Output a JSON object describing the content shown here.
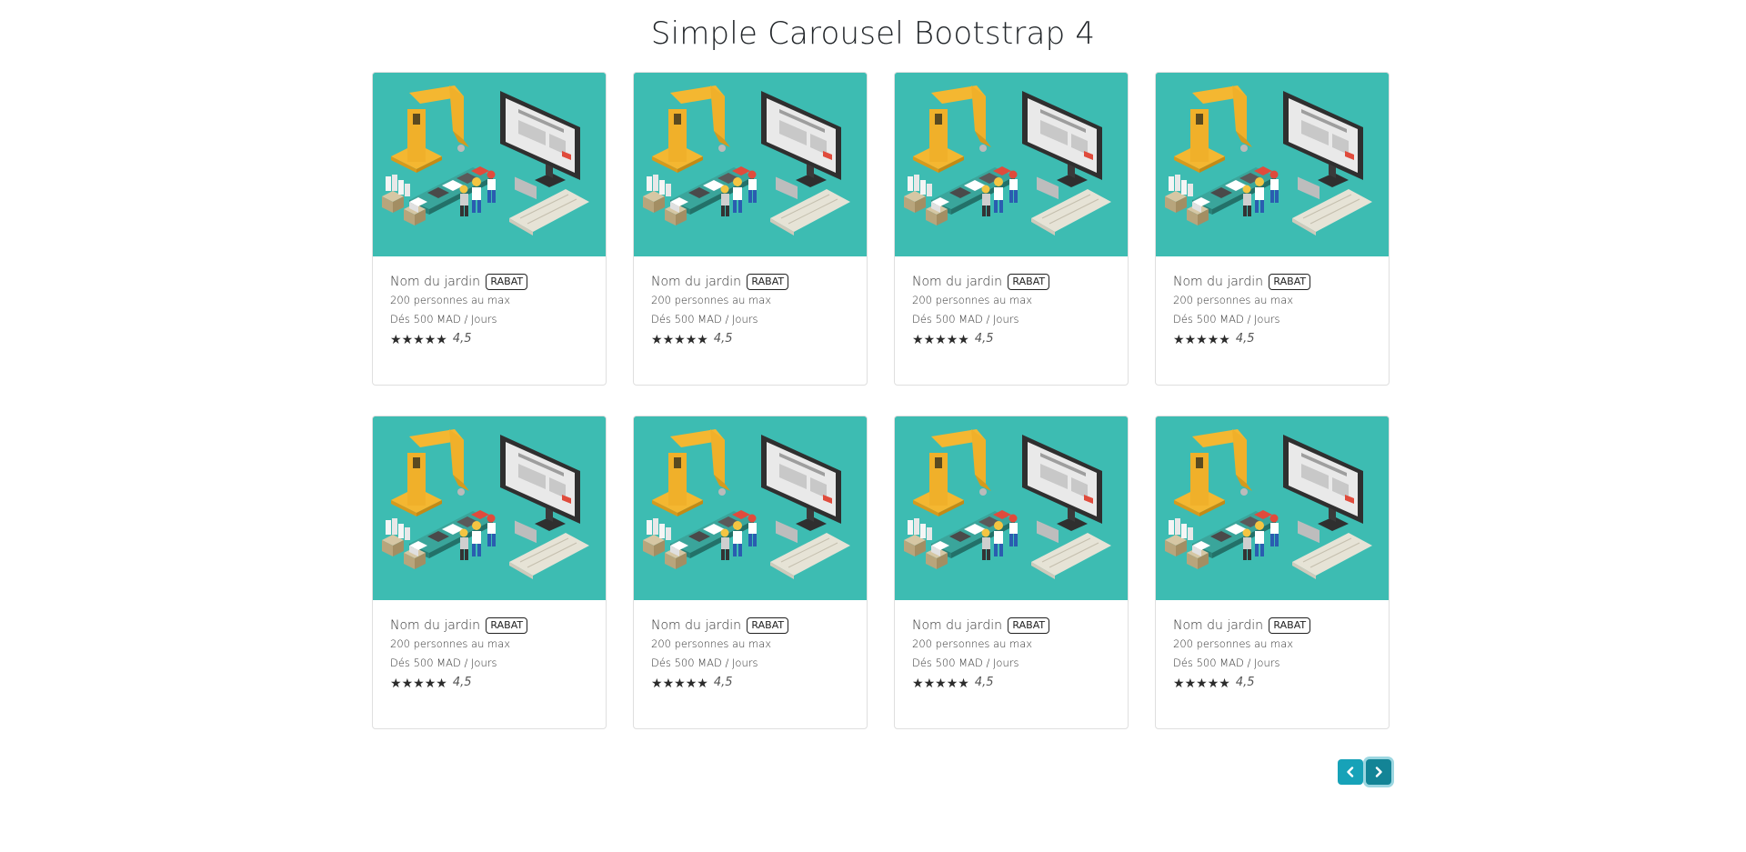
{
  "page": {
    "title": "Simple Carousel Bootstrap 4"
  },
  "theme": {
    "image_bg": "#3dbcb2",
    "button_bg": "#17a2b8"
  },
  "cards": [
    {
      "name": "Nom du jardin",
      "city": "RABAT",
      "capacity": "200 personnes au max",
      "price": "Dés 500 MAD / Jours",
      "stars": 5,
      "rating": "4,5",
      "image": "factory-illustration"
    },
    {
      "name": "Nom du jardin",
      "city": "RABAT",
      "capacity": "200 personnes au max",
      "price": "Dés 500 MAD / Jours",
      "stars": 5,
      "rating": "4,5",
      "image": "factory-illustration"
    },
    {
      "name": "Nom du jardin",
      "city": "RABAT",
      "capacity": "200 personnes au max",
      "price": "Dés 500 MAD / Jours",
      "stars": 5,
      "rating": "4,5",
      "image": "factory-illustration"
    },
    {
      "name": "Nom du jardin",
      "city": "RABAT",
      "capacity": "200 personnes au max",
      "price": "Dés 500 MAD / Jours",
      "stars": 5,
      "rating": "4,5",
      "image": "factory-illustration"
    },
    {
      "name": "Nom du jardin",
      "city": "RABAT",
      "capacity": "200 personnes au max",
      "price": "Dés 500 MAD / Jours",
      "stars": 5,
      "rating": "4,5",
      "image": "factory-illustration"
    },
    {
      "name": "Nom du jardin",
      "city": "RABAT",
      "capacity": "200 personnes au max",
      "price": "Dés 500 MAD / Jours",
      "stars": 5,
      "rating": "4,5",
      "image": "factory-illustration"
    },
    {
      "name": "Nom du jardin",
      "city": "RABAT",
      "capacity": "200 personnes au max",
      "price": "Dés 500 MAD / Jours",
      "stars": 5,
      "rating": "4,5",
      "image": "factory-illustration"
    },
    {
      "name": "Nom du jardin",
      "city": "RABAT",
      "capacity": "200 personnes au max",
      "price": "Dés 500 MAD / Jours",
      "stars": 5,
      "rating": "4,5",
      "image": "factory-illustration"
    }
  ],
  "controls": {
    "prev_icon": "chevron-left-icon",
    "next_icon": "chevron-right-icon"
  }
}
